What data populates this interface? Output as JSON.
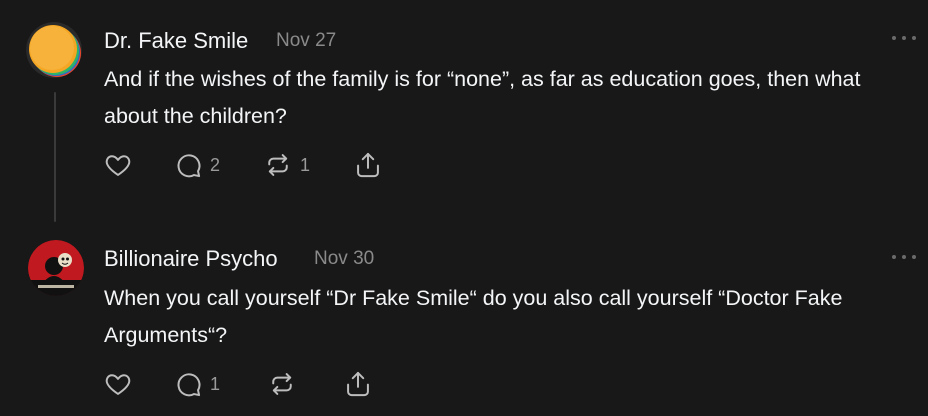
{
  "posts": [
    {
      "author": "Dr. Fake Smile",
      "date": "Nov 27",
      "text": "And if the wishes of the family is for “none”, as far as education goes, then what about the children?",
      "reply_count": "2",
      "repost_count": "1"
    },
    {
      "author": "Billionaire Psycho",
      "date": "Nov 30",
      "text": "When you call yourself “Dr Fake Smile“ do you also call yourself “Doctor Fake Arguments“?",
      "reply_count": "1"
    }
  ],
  "icons": {
    "like": "heart-icon",
    "reply": "comment-icon",
    "repost": "repost-icon",
    "share": "share-icon",
    "more": "more-icon"
  },
  "colors": {
    "background": "#181818",
    "text_primary": "#f3f5f7",
    "text_secondary": "#8a8a8a",
    "icon": "#bdbdbd"
  }
}
